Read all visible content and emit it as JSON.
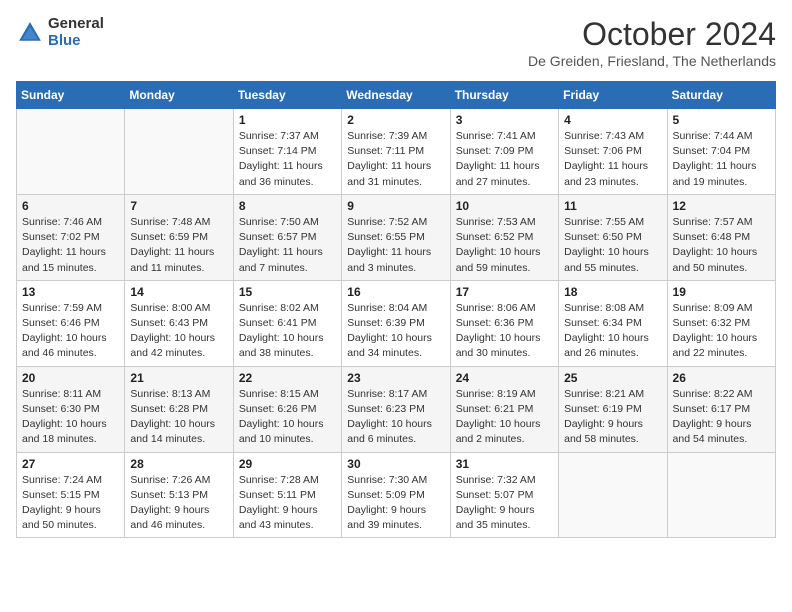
{
  "header": {
    "logo_general": "General",
    "logo_blue": "Blue",
    "title": "October 2024",
    "location": "De Greiden, Friesland, The Netherlands"
  },
  "weekdays": [
    "Sunday",
    "Monday",
    "Tuesday",
    "Wednesday",
    "Thursday",
    "Friday",
    "Saturday"
  ],
  "weeks": [
    [
      {
        "day": "",
        "sunrise": "",
        "sunset": "",
        "daylight": ""
      },
      {
        "day": "",
        "sunrise": "",
        "sunset": "",
        "daylight": ""
      },
      {
        "day": "1",
        "sunrise": "Sunrise: 7:37 AM",
        "sunset": "Sunset: 7:14 PM",
        "daylight": "Daylight: 11 hours and 36 minutes."
      },
      {
        "day": "2",
        "sunrise": "Sunrise: 7:39 AM",
        "sunset": "Sunset: 7:11 PM",
        "daylight": "Daylight: 11 hours and 31 minutes."
      },
      {
        "day": "3",
        "sunrise": "Sunrise: 7:41 AM",
        "sunset": "Sunset: 7:09 PM",
        "daylight": "Daylight: 11 hours and 27 minutes."
      },
      {
        "day": "4",
        "sunrise": "Sunrise: 7:43 AM",
        "sunset": "Sunset: 7:06 PM",
        "daylight": "Daylight: 11 hours and 23 minutes."
      },
      {
        "day": "5",
        "sunrise": "Sunrise: 7:44 AM",
        "sunset": "Sunset: 7:04 PM",
        "daylight": "Daylight: 11 hours and 19 minutes."
      }
    ],
    [
      {
        "day": "6",
        "sunrise": "Sunrise: 7:46 AM",
        "sunset": "Sunset: 7:02 PM",
        "daylight": "Daylight: 11 hours and 15 minutes."
      },
      {
        "day": "7",
        "sunrise": "Sunrise: 7:48 AM",
        "sunset": "Sunset: 6:59 PM",
        "daylight": "Daylight: 11 hours and 11 minutes."
      },
      {
        "day": "8",
        "sunrise": "Sunrise: 7:50 AM",
        "sunset": "Sunset: 6:57 PM",
        "daylight": "Daylight: 11 hours and 7 minutes."
      },
      {
        "day": "9",
        "sunrise": "Sunrise: 7:52 AM",
        "sunset": "Sunset: 6:55 PM",
        "daylight": "Daylight: 11 hours and 3 minutes."
      },
      {
        "day": "10",
        "sunrise": "Sunrise: 7:53 AM",
        "sunset": "Sunset: 6:52 PM",
        "daylight": "Daylight: 10 hours and 59 minutes."
      },
      {
        "day": "11",
        "sunrise": "Sunrise: 7:55 AM",
        "sunset": "Sunset: 6:50 PM",
        "daylight": "Daylight: 10 hours and 55 minutes."
      },
      {
        "day": "12",
        "sunrise": "Sunrise: 7:57 AM",
        "sunset": "Sunset: 6:48 PM",
        "daylight": "Daylight: 10 hours and 50 minutes."
      }
    ],
    [
      {
        "day": "13",
        "sunrise": "Sunrise: 7:59 AM",
        "sunset": "Sunset: 6:46 PM",
        "daylight": "Daylight: 10 hours and 46 minutes."
      },
      {
        "day": "14",
        "sunrise": "Sunrise: 8:00 AM",
        "sunset": "Sunset: 6:43 PM",
        "daylight": "Daylight: 10 hours and 42 minutes."
      },
      {
        "day": "15",
        "sunrise": "Sunrise: 8:02 AM",
        "sunset": "Sunset: 6:41 PM",
        "daylight": "Daylight: 10 hours and 38 minutes."
      },
      {
        "day": "16",
        "sunrise": "Sunrise: 8:04 AM",
        "sunset": "Sunset: 6:39 PM",
        "daylight": "Daylight: 10 hours and 34 minutes."
      },
      {
        "day": "17",
        "sunrise": "Sunrise: 8:06 AM",
        "sunset": "Sunset: 6:36 PM",
        "daylight": "Daylight: 10 hours and 30 minutes."
      },
      {
        "day": "18",
        "sunrise": "Sunrise: 8:08 AM",
        "sunset": "Sunset: 6:34 PM",
        "daylight": "Daylight: 10 hours and 26 minutes."
      },
      {
        "day": "19",
        "sunrise": "Sunrise: 8:09 AM",
        "sunset": "Sunset: 6:32 PM",
        "daylight": "Daylight: 10 hours and 22 minutes."
      }
    ],
    [
      {
        "day": "20",
        "sunrise": "Sunrise: 8:11 AM",
        "sunset": "Sunset: 6:30 PM",
        "daylight": "Daylight: 10 hours and 18 minutes."
      },
      {
        "day": "21",
        "sunrise": "Sunrise: 8:13 AM",
        "sunset": "Sunset: 6:28 PM",
        "daylight": "Daylight: 10 hours and 14 minutes."
      },
      {
        "day": "22",
        "sunrise": "Sunrise: 8:15 AM",
        "sunset": "Sunset: 6:26 PM",
        "daylight": "Daylight: 10 hours and 10 minutes."
      },
      {
        "day": "23",
        "sunrise": "Sunrise: 8:17 AM",
        "sunset": "Sunset: 6:23 PM",
        "daylight": "Daylight: 10 hours and 6 minutes."
      },
      {
        "day": "24",
        "sunrise": "Sunrise: 8:19 AM",
        "sunset": "Sunset: 6:21 PM",
        "daylight": "Daylight: 10 hours and 2 minutes."
      },
      {
        "day": "25",
        "sunrise": "Sunrise: 8:21 AM",
        "sunset": "Sunset: 6:19 PM",
        "daylight": "Daylight: 9 hours and 58 minutes."
      },
      {
        "day": "26",
        "sunrise": "Sunrise: 8:22 AM",
        "sunset": "Sunset: 6:17 PM",
        "daylight": "Daylight: 9 hours and 54 minutes."
      }
    ],
    [
      {
        "day": "27",
        "sunrise": "Sunrise: 7:24 AM",
        "sunset": "Sunset: 5:15 PM",
        "daylight": "Daylight: 9 hours and 50 minutes."
      },
      {
        "day": "28",
        "sunrise": "Sunrise: 7:26 AM",
        "sunset": "Sunset: 5:13 PM",
        "daylight": "Daylight: 9 hours and 46 minutes."
      },
      {
        "day": "29",
        "sunrise": "Sunrise: 7:28 AM",
        "sunset": "Sunset: 5:11 PM",
        "daylight": "Daylight: 9 hours and 43 minutes."
      },
      {
        "day": "30",
        "sunrise": "Sunrise: 7:30 AM",
        "sunset": "Sunset: 5:09 PM",
        "daylight": "Daylight: 9 hours and 39 minutes."
      },
      {
        "day": "31",
        "sunrise": "Sunrise: 7:32 AM",
        "sunset": "Sunset: 5:07 PM",
        "daylight": "Daylight: 9 hours and 35 minutes."
      },
      {
        "day": "",
        "sunrise": "",
        "sunset": "",
        "daylight": ""
      },
      {
        "day": "",
        "sunrise": "",
        "sunset": "",
        "daylight": ""
      }
    ]
  ]
}
